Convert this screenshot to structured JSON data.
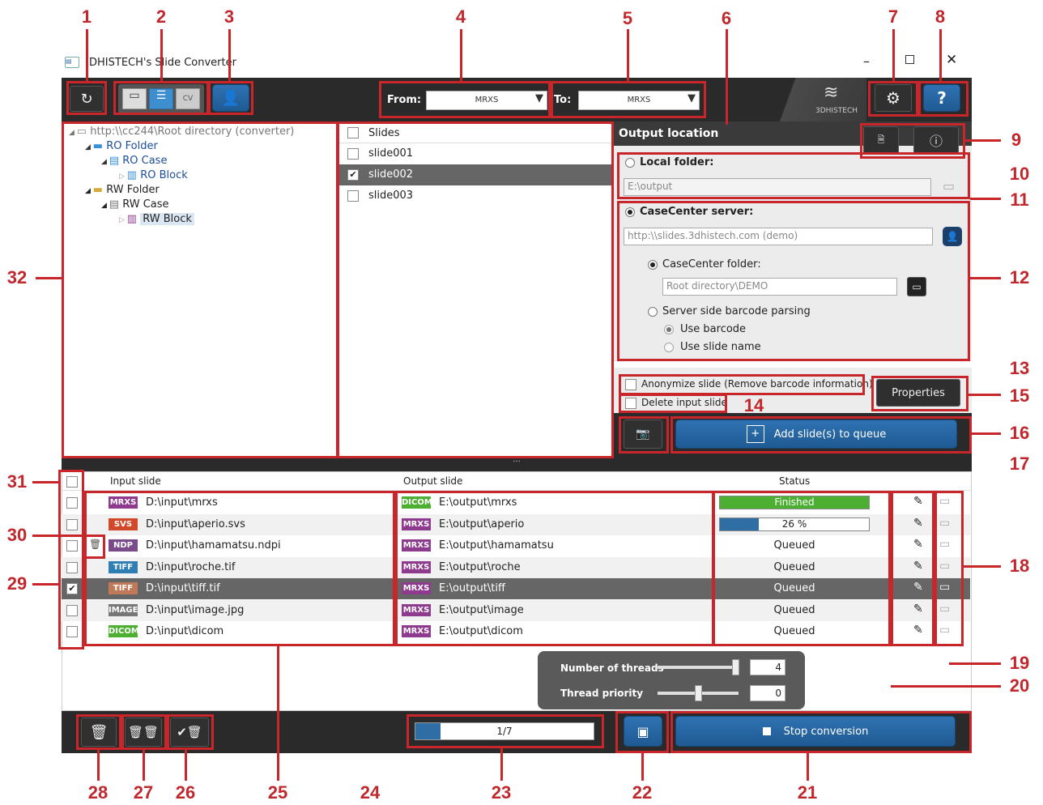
{
  "window": {
    "title": "DHISTECH's Slide Converter",
    "logo_text": "3DHISTECH"
  },
  "toolbar": {
    "from_label": "From:",
    "from_value": "MRXS",
    "to_label": "To:",
    "to_value": "MRXS"
  },
  "tree": {
    "items": [
      {
        "label": "http:\\\\cc244\\Root directory (converter)"
      },
      {
        "label": "RO Folder"
      },
      {
        "label": "RO Case"
      },
      {
        "label": "RO Block"
      },
      {
        "label": "RW Folder"
      },
      {
        "label": "RW Case"
      },
      {
        "label": "RW Block"
      }
    ]
  },
  "slides": {
    "header": "Slides",
    "items": [
      {
        "label": "slide001",
        "checked": false
      },
      {
        "label": "slide002",
        "checked": true
      },
      {
        "label": "slide003",
        "checked": false
      }
    ]
  },
  "output": {
    "title": "Output location",
    "local_label": "Local folder:",
    "local_path": "E:\\output",
    "casecenter_label": "CaseCenter server:",
    "casecenter_url": "http:\\\\slides.3dhistech.com (demo)",
    "cc_folder_label": "CaseCenter folder:",
    "cc_folder_path": "Root directory\\DEMO",
    "barcode_label": "Server side barcode parsing",
    "use_barcode": "Use barcode",
    "use_slide_name": "Use slide name",
    "anonymize_label": "Anonymize slide (Remove barcode information)",
    "delete_label": "Delete input slide",
    "properties_label": "Properties",
    "add_queue_label": "Add slide(s) to queue"
  },
  "queue": {
    "headers": {
      "input": "Input slide",
      "output": "Output slide",
      "status": "Status"
    },
    "rows": [
      {
        "in_badge": "MRXS",
        "in_color": "#8e3a8e",
        "input": "D:\\input\\mrxs",
        "out_badge": "DICOM",
        "out_color": "#4caf32",
        "output": "E:\\output\\mrxs",
        "status": "Finished",
        "progress": 1.0,
        "checked": false
      },
      {
        "in_badge": "SVS",
        "in_color": "#d0492a",
        "input": "D:\\input\\aperio.svs",
        "out_badge": "MRXS",
        "out_color": "#8e3a8e",
        "output": "E:\\output\\aperio",
        "status": "26 %",
        "progress": 0.26,
        "checked": false
      },
      {
        "in_badge": "NDP",
        "in_color": "#7a4a8a",
        "input": "D:\\input\\hamamatsu.ndpi",
        "out_badge": "MRXS",
        "out_color": "#8e3a8e",
        "output": "E:\\output\\hamamatsu",
        "status": "Queued",
        "checked": false
      },
      {
        "in_badge": "TIFF",
        "in_color": "#2f7fb5",
        "input": "D:\\input\\roche.tif",
        "out_badge": "MRXS",
        "out_color": "#8e3a8e",
        "output": "E:\\output\\roche",
        "status": "Queued",
        "checked": false
      },
      {
        "in_badge": "TIFF",
        "in_color": "#c07a5a",
        "input": "D:\\input\\tiff.tif",
        "out_badge": "MRXS",
        "out_color": "#8e3a8e",
        "output": "E:\\output\\tiff",
        "status": "Queued",
        "checked": true
      },
      {
        "in_badge": "IMAGE",
        "in_color": "#777777",
        "input": "D:\\input\\image.jpg",
        "out_badge": "MRXS",
        "out_color": "#8e3a8e",
        "output": "E:\\output\\image",
        "status": "Queued",
        "checked": false
      },
      {
        "in_badge": "DICOM",
        "in_color": "#4caf32",
        "input": "D:\\input\\dicom",
        "out_badge": "MRXS",
        "out_color": "#8e3a8e",
        "output": "E:\\output\\dicom",
        "status": "Queued",
        "checked": false
      }
    ]
  },
  "threads": {
    "threads_label": "Number of threads",
    "threads_value": "4",
    "threads_level": 1.0,
    "priority_label": "Thread priority",
    "priority_value": "0",
    "priority_level": 0.5
  },
  "bottom": {
    "progress_text": "1/7",
    "progress_fraction": 0.143,
    "stop_label": "Stop conversion",
    "dots": "..."
  },
  "callouts": [
    "1",
    "2",
    "3",
    "4",
    "5",
    "6",
    "7",
    "8",
    "9",
    "10",
    "11",
    "12",
    "13",
    "14",
    "15",
    "16",
    "17",
    "18",
    "19",
    "20",
    "21",
    "22",
    "23",
    "24",
    "25",
    "26",
    "27",
    "28",
    "29",
    "30",
    "31",
    "32"
  ]
}
